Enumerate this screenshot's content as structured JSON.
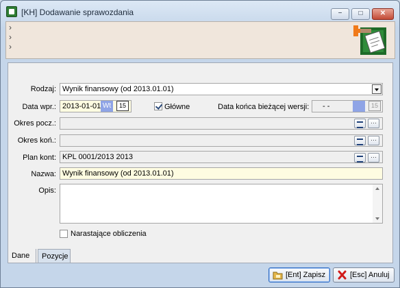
{
  "window": {
    "title": "[KH] Dodawanie sprawozdania",
    "controls": {
      "minimize": "−",
      "maximize": "□",
      "close": "✕"
    }
  },
  "toolbar": {
    "chevrons": [
      "›",
      "›",
      "›"
    ]
  },
  "form": {
    "rodzaj": {
      "label": "Rodzaj:",
      "value": "Wynik finansowy (od  2013.01.01)"
    },
    "data_wpr": {
      "label": "Data wpr.:",
      "value": "2013-01-01",
      "day": "Wt",
      "calendar_glyph": "15"
    },
    "glowne": {
      "label": "Główne",
      "checked": true
    },
    "data_konca": {
      "label": "Data końca bieżącej wersji:",
      "value": "- -",
      "calendar_glyph": "15"
    },
    "okres_pocz": {
      "label": "Okres pocz.:",
      "value": ""
    },
    "okres_kon": {
      "label": "Okres koń.:",
      "value": ""
    },
    "plan_kont": {
      "label": "Plan kont:",
      "value": "KPL 0001/2013 2013"
    },
    "nazwa": {
      "label": "Nazwa:",
      "value": "Wynik finansowy (od  2013.01.01)"
    },
    "opis": {
      "label": "Opis:",
      "value": ""
    },
    "narastajace": {
      "label": "Narastające obliczenia",
      "checked": false
    },
    "ellipsis": "···"
  },
  "tabs": [
    {
      "label": "Dane",
      "active": true
    },
    {
      "label": "Pozycje",
      "active": false
    }
  ],
  "buttons": {
    "save": "[Ent] Zapisz",
    "cancel": "[Esc] Anuluj"
  },
  "colors": {
    "titlebar": "#c5d6ea",
    "toolbar": "#f0e6dc",
    "panel": "#f0f0f0",
    "yellow_field": "#fefce1",
    "day_badge": "#8fa4e6"
  }
}
